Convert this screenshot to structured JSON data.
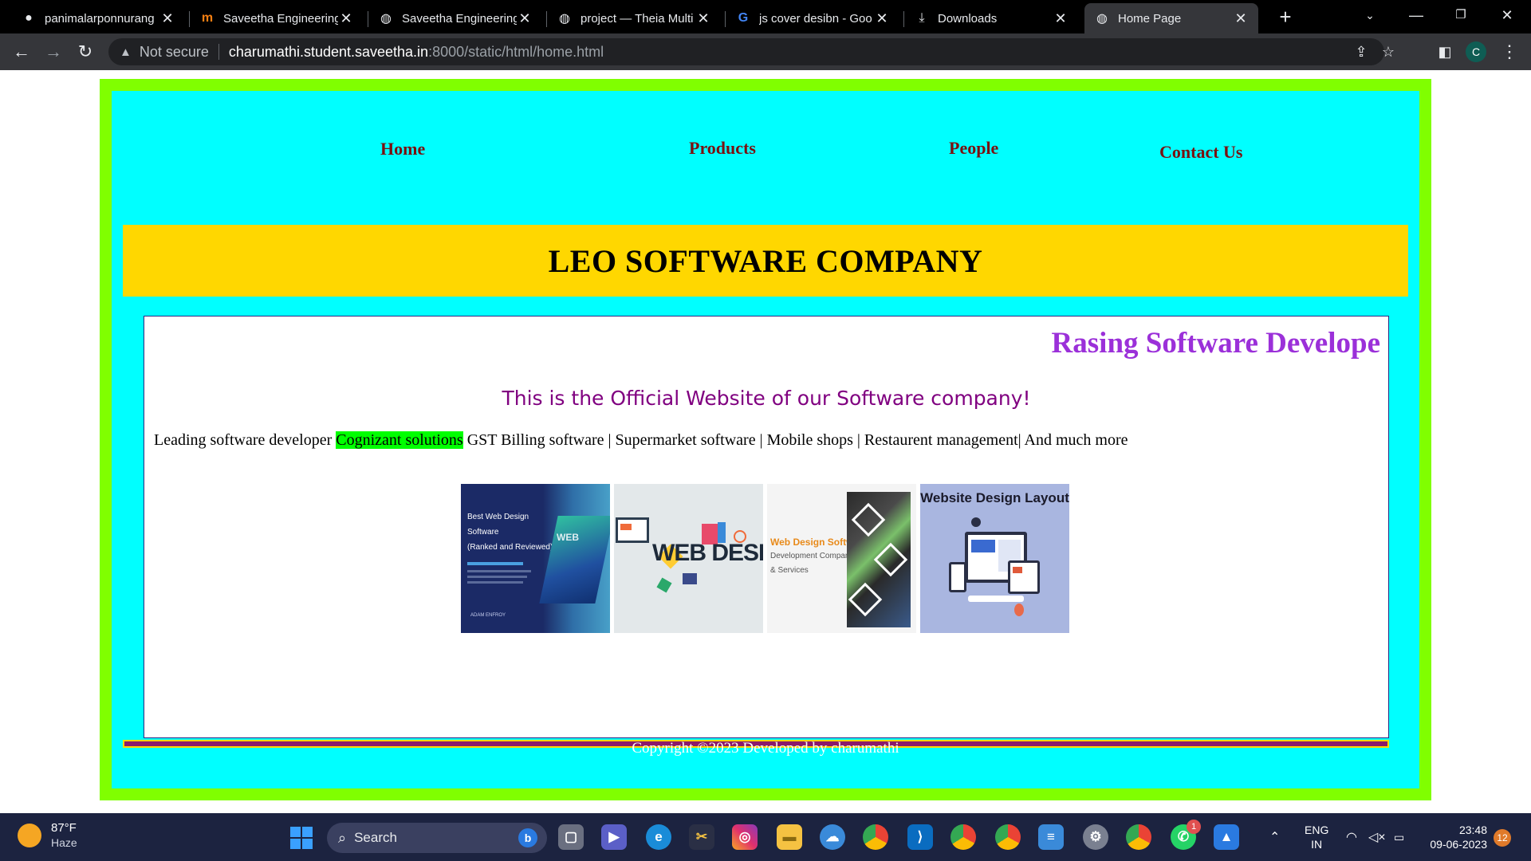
{
  "browser": {
    "tabs": [
      {
        "title": "panimalarponnurang",
        "icon": "github-icon"
      },
      {
        "title": "Saveetha Engineering",
        "icon": "moodle-icon"
      },
      {
        "title": "Saveetha Engineering",
        "icon": "globe-icon"
      },
      {
        "title": "project — Theia Multi",
        "icon": "globe-icon"
      },
      {
        "title": "js cover desibn - Goo",
        "icon": "google-icon"
      },
      {
        "title": "Downloads",
        "icon": "download-icon"
      },
      {
        "title": "Home Page",
        "icon": "globe-icon",
        "active": true
      }
    ],
    "security_label": "Not secure",
    "url_host": "charumathi.student.saveetha.in",
    "url_path": ":8000/static/html/home.html",
    "profile_initial": "C"
  },
  "page": {
    "nav": {
      "home": "Home",
      "products": "Products",
      "people": "People",
      "contact": "Contact Us"
    },
    "banner_title": "LEO SOFTWARE COMPANY",
    "marquee": "Rasing Software Develope",
    "official": "This is the Official Website of our Software company!",
    "leading": {
      "before": "Leading software developer ",
      "highlight": "Cognizant solutions",
      "after": " GST Billing software | Supermarket software | Mobile shops | Restaurent management| And much more"
    },
    "images": [
      {
        "lines": [
          "Best Web Design",
          "Software",
          "(Ranked and Reviewed)"
        ],
        "bg": "#1b2a66",
        "footer": "ADAM ENFROY"
      },
      {
        "lines": [
          "WEB DESIGN"
        ],
        "bg": "#e3e8ea"
      },
      {
        "lines": [
          "Web Design Software",
          "Development Company",
          "& Services"
        ],
        "bg": "#f4f4f4"
      },
      {
        "lines": [
          "Website Design Layout"
        ],
        "bg": "#a9b6e0"
      }
    ],
    "footer": "Copyright ©2023 Developed by charumathi"
  },
  "taskbar": {
    "weather_temp": "87°F",
    "weather_desc": "Haze",
    "search_label": "Search",
    "lang_1": "ENG",
    "lang_2": "IN",
    "time": "23:48",
    "date": "09-06-2023",
    "notifications": "12",
    "whatsapp_badge": "1"
  },
  "colors": {
    "frame_green": "#80ff00",
    "body_cyan": "#00ffff",
    "banner_gold": "#ffd700",
    "marquee_purple": "#9b30d9",
    "official_purple": "#800080",
    "highlight_green": "#00ff00",
    "nav_maroon": "#7a1010",
    "footer_bar": "#8b1a6a"
  }
}
